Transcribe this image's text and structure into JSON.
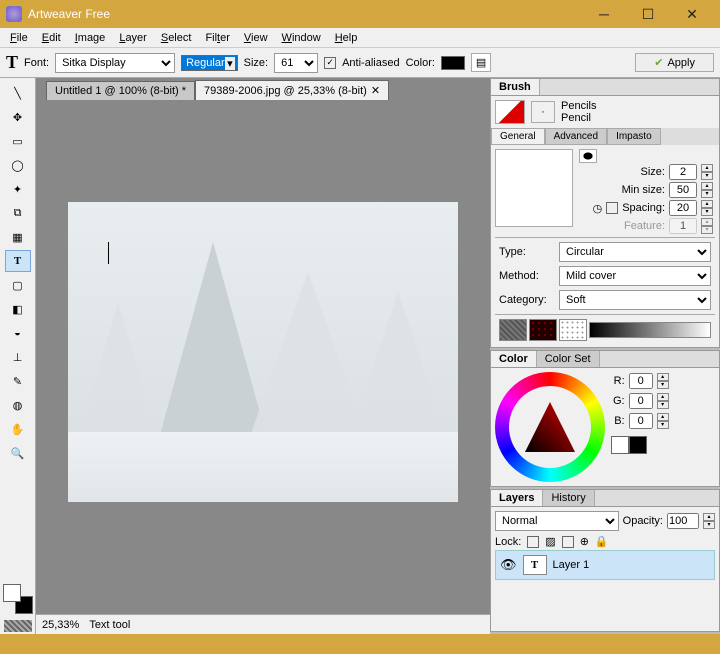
{
  "window": {
    "title": "Artweaver Free"
  },
  "menu": [
    "File",
    "Edit",
    "Image",
    "Layer",
    "Select",
    "Filter",
    "View",
    "Window",
    "Help"
  ],
  "toolbar": {
    "font_label": "Font:",
    "font": "Sitka Display",
    "style": "Regular",
    "size_label": "Size:",
    "size": "61",
    "aa": "Anti-aliased",
    "color_label": "Color:",
    "apply": "Apply"
  },
  "docs": {
    "t1": "Untitled 1 @ 100% (8-bit) *",
    "t2": "79389-2006.jpg @ 25,33% (8-bit)"
  },
  "status": {
    "zoom": "25,33%",
    "tool": "Text tool"
  },
  "brush": {
    "title": "Brush",
    "cat": "Pencils",
    "name": "Pencil",
    "tabs": {
      "g": "General",
      "a": "Advanced",
      "i": "Impasto"
    },
    "size_l": "Size:",
    "size": "2",
    "min_l": "Min size:",
    "min": "50",
    "spc_l": "Spacing:",
    "spc": "20",
    "fea_l": "Feature:",
    "fea": "1",
    "type_l": "Type:",
    "type": "Circular",
    "method_l": "Method:",
    "method": "Mild cover",
    "catg_l": "Category:",
    "catg": "Soft"
  },
  "color": {
    "t1": "Color",
    "t2": "Color Set",
    "r_l": "R:",
    "g_l": "G:",
    "b_l": "B:",
    "r": "0",
    "g": "0",
    "b": "0"
  },
  "layers": {
    "t1": "Layers",
    "t2": "History",
    "mode": "Normal",
    "op_l": "Opacity:",
    "op": "100",
    "lock": "Lock:",
    "l1": "Layer 1"
  }
}
